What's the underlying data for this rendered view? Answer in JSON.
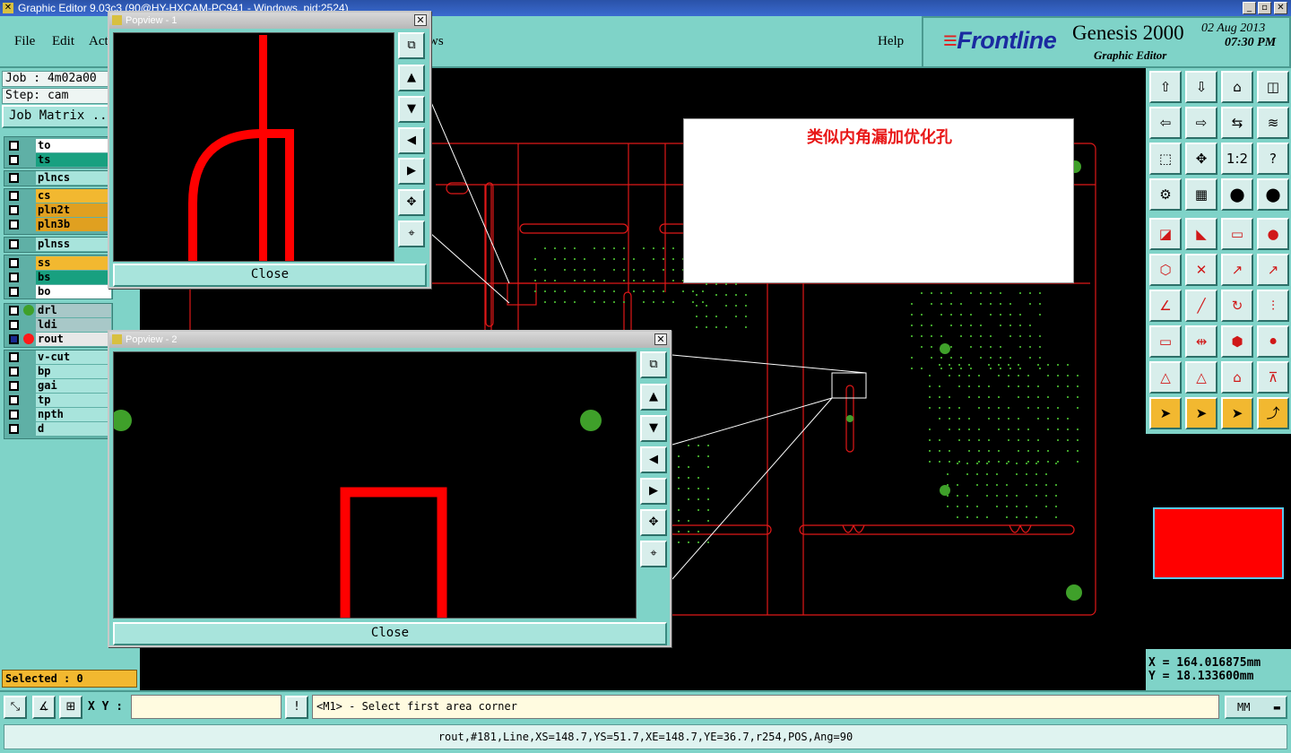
{
  "window": {
    "title": "Graphic Editor 9.03c3 (90@HY-HXCAM-PC941 - Windows, pid:2524)",
    "min": "_",
    "max": "▫",
    "close": "✕"
  },
  "menu": {
    "file": "File",
    "edit": "Edit",
    "actions": "Act",
    "views": "ws",
    "help": "Help"
  },
  "brand": {
    "logo": "Frontline",
    "stripes": "≡",
    "product": "Genesis 2000",
    "subtitle": "Graphic Editor",
    "date": "02 Aug 2013",
    "time": "07:30 PM"
  },
  "job": {
    "job": "Job : 4m02a00",
    "step": "Step: cam",
    "matrix_button": "Job Matrix ..."
  },
  "layers": [
    {
      "name": "to",
      "color": "#ffffff"
    },
    {
      "name": "ts",
      "color": "#18a080"
    },
    {
      "name": "plncs",
      "color": "#a8e4dc"
    },
    {
      "name": "cs",
      "color": "#f2b830"
    },
    {
      "name": "pln2t",
      "color": "#e0a020"
    },
    {
      "name": "pln3b",
      "color": "#e0a020"
    },
    {
      "name": "plnss",
      "color": "#a8e4dc"
    },
    {
      "name": "ss",
      "color": "#f2b830"
    },
    {
      "name": "bs",
      "color": "#18a080"
    },
    {
      "name": "bo",
      "color": "#ffffff"
    },
    {
      "name": "drl",
      "color": "#a8c8c8"
    },
    {
      "name": "ldi",
      "color": "#a8c8c8"
    },
    {
      "name": "rout",
      "color": "#e8e8e8"
    },
    {
      "name": "v-cut",
      "color": "#a8e4dc"
    },
    {
      "name": "bp",
      "color": "#a8e4dc"
    },
    {
      "name": "gai",
      "color": "#a8e4dc"
    },
    {
      "name": "tp",
      "color": "#a8e4dc"
    },
    {
      "name": "npth",
      "color": "#a8e4dc"
    },
    {
      "name": "d",
      "color": "#a8e4dc"
    }
  ],
  "selected": "Selected : 0",
  "annotation": "类似内角漏加优化孔",
  "popviews": [
    {
      "title": "Popview - 1",
      "close": "Close"
    },
    {
      "title": "Popview - 2",
      "close": "Close"
    }
  ],
  "toolbar_icons": [
    "layer-up-icon",
    "layer-down-icon",
    "home-icon",
    "window-icon",
    "move-left-icon",
    "move-right-icon",
    "swap-icon",
    "snake-icon",
    "fit-icon",
    "center-icon",
    "scale-icon",
    "help-icon",
    "tools-icon",
    "grid-icon",
    "feature-color-icon",
    "feature-red-icon",
    "select-icon",
    "measure-icon",
    "ruler-icon",
    "pad-icon",
    "connect-icon",
    "cross-icon",
    "drag-icon",
    "move-icon",
    "angle-icon",
    "line-icon",
    "rotate-icon",
    "align-icon",
    "polarity-icon",
    "bar-icon",
    "resize-icon",
    "blob-icon",
    "triangle-icon",
    "triangle-pick-icon",
    "arch-icon",
    "arch-x-icon",
    "pointer-icon",
    "pointer-box-icon",
    "pointer-rect-icon",
    "pointer-net-icon"
  ],
  "toolbar_labels": {
    "scale": "1:2",
    "help": "?"
  },
  "coords": {
    "x": "X = 164.016875mm",
    "y": "Y = 18.133600mm"
  },
  "command": {
    "xy_label": "X Y :",
    "xy_value": "",
    "prompt": "<M1> - Select first area corner",
    "units": "MM"
  },
  "status": "rout,#181,Line,XS=148.7,YS=51.7,XE=148.7,YE=36.7,r254,POS,Ang=90",
  "colors": {
    "panel": "#7fd3c8",
    "feature": "#ff0000",
    "pad": "#3fa02a"
  }
}
